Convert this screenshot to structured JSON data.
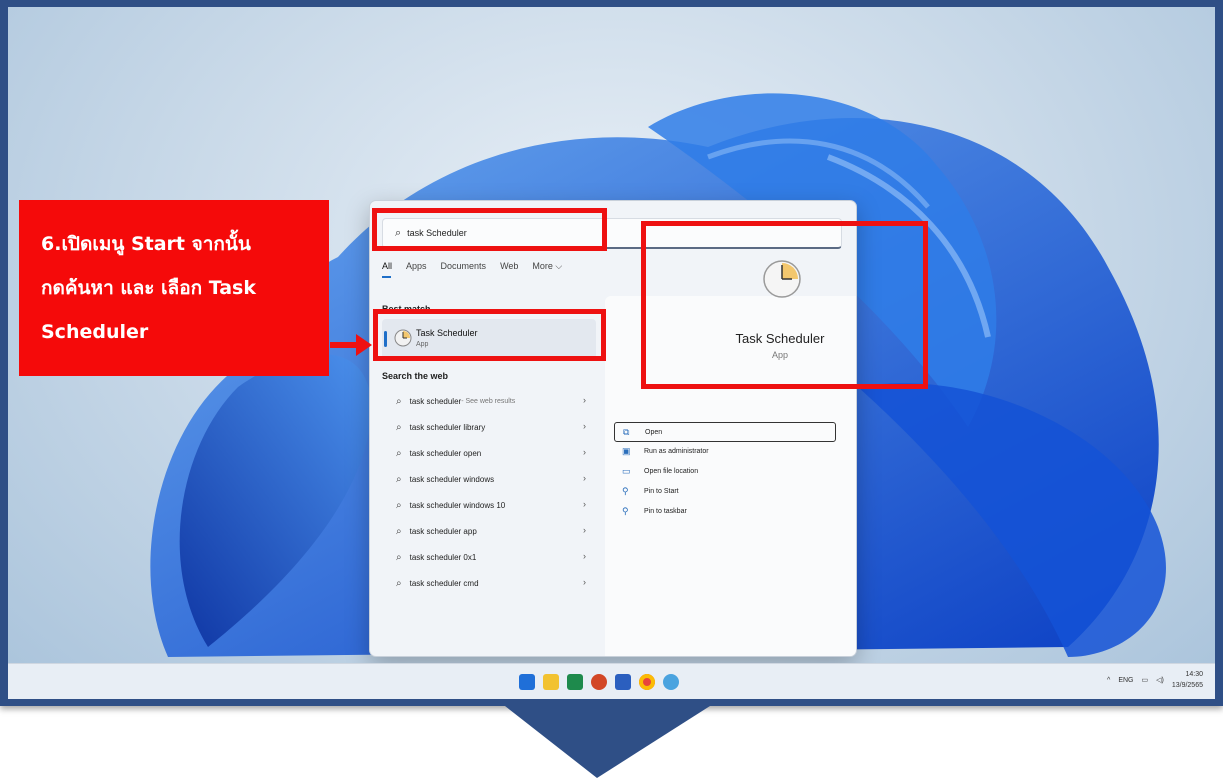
{
  "desktop": {
    "search": {
      "query": "task Scheduler"
    },
    "tabs": [
      "All",
      "Apps",
      "Documents",
      "Web",
      "More ⌵"
    ],
    "best_match": {
      "title": "Best match",
      "name": "Task Scheduler",
      "kind": "App"
    },
    "web": {
      "title": "Search the web",
      "items": [
        {
          "text": "task scheduler",
          "suffix": " - See web results"
        },
        {
          "text": "task scheduler library",
          "suffix": ""
        },
        {
          "text": "task scheduler open",
          "suffix": ""
        },
        {
          "text": "task scheduler windows",
          "suffix": ""
        },
        {
          "text": "task scheduler windows 10",
          "suffix": ""
        },
        {
          "text": "task scheduler app",
          "suffix": ""
        },
        {
          "text": "task scheduler 0x1",
          "suffix": ""
        },
        {
          "text": "task scheduler cmd",
          "suffix": ""
        }
      ]
    },
    "preview": {
      "name": "Task Scheduler",
      "kind": "App",
      "actions": [
        "Open",
        "Run as administrator",
        "Open file location",
        "Pin to Start",
        "Pin to taskbar"
      ]
    },
    "tray": {
      "lang": "ENG",
      "time": "14:30",
      "date": "13/9/2565"
    }
  },
  "callout": {
    "lines": [
      "6.เปิดเมนู Start จากนั้น",
      "กดค้นหา และ เลือก Task",
      "Scheduler"
    ]
  },
  "colors": {
    "frame": "#2f4f86",
    "highlight": "#ee1111",
    "accent": "#1f6fc8"
  }
}
